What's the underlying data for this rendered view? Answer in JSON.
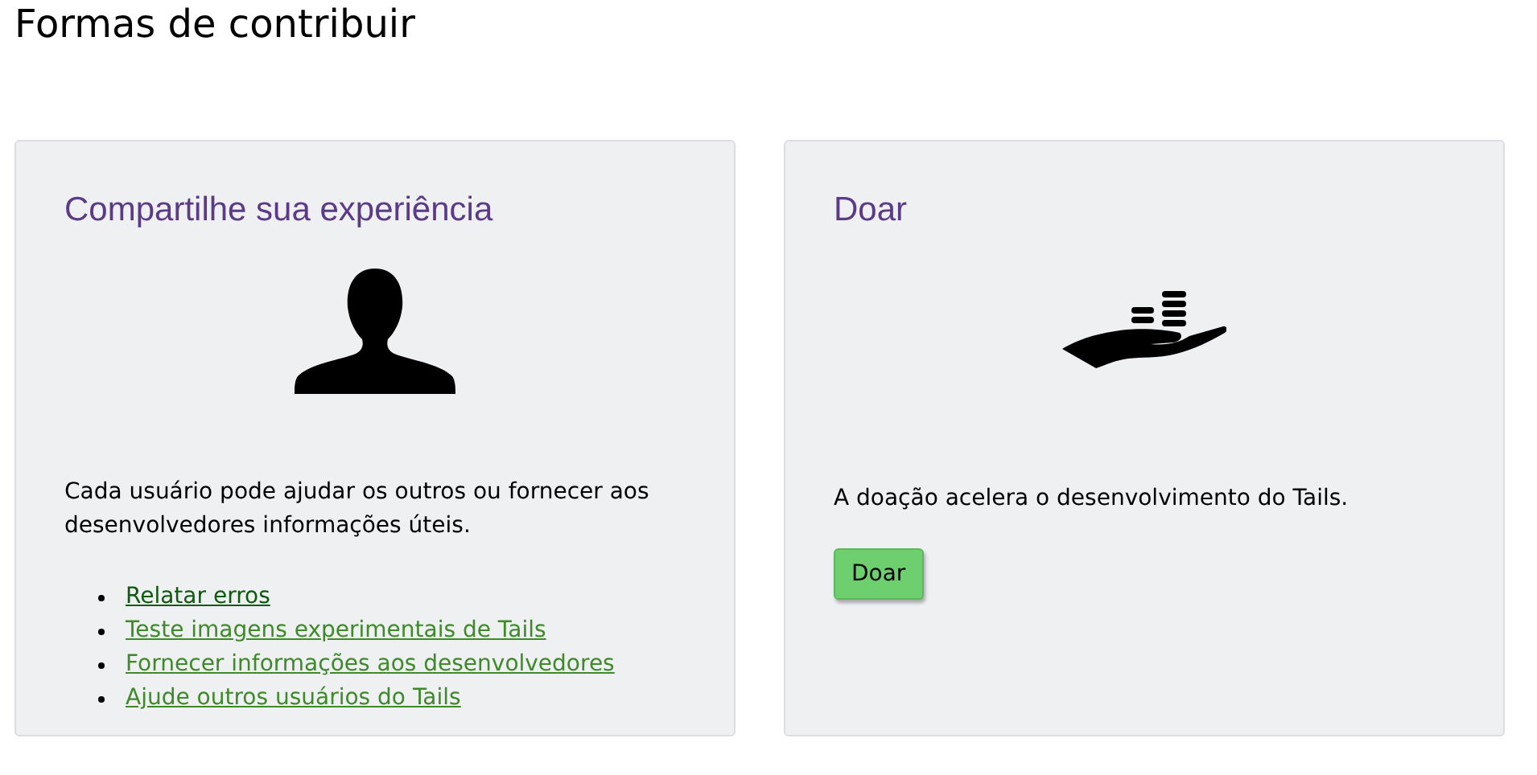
{
  "title": "Formas de contribuir",
  "cards": [
    {
      "heading": "Compartilhe sua experiência",
      "kind": "person",
      "text": "Cada usuário pode ajudar os outros ou fornecer aos desenvolvedores informações úteis.",
      "links": [
        {
          "label": "Relatar erros",
          "visited": true
        },
        {
          "label": "Teste imagens experimentais de Tails",
          "visited": false
        },
        {
          "label": "Fornecer informações aos desenvolvedores",
          "visited": false
        },
        {
          "label": "Ajude outros usuários do Tails",
          "visited": false
        }
      ]
    },
    {
      "heading": "Doar",
      "kind": "donate",
      "text": "A doação acelera o desenvolvimento do Tails.",
      "button": "Doar"
    }
  ]
}
